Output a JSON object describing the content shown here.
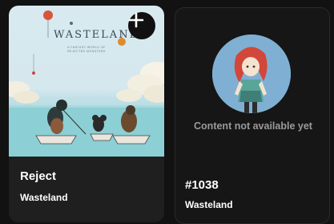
{
  "cards": [
    {
      "title": "Reject",
      "collection": "Wasteland",
      "artwork": {
        "heading": "WASTELAND",
        "tagline": "A FANTASY WORLD OF REJECTED MONSTERS"
      },
      "add_icon": "plus-icon"
    },
    {
      "title": "#1038",
      "collection": "Wasteland",
      "status_text": "Content not available yet"
    }
  ],
  "colors": {
    "background": "#121212",
    "card": "#1f1f1f",
    "muted_text": "#9a9a9a",
    "sea": "#8fd0d6",
    "avatar_bg": "#7fb0d3"
  }
}
